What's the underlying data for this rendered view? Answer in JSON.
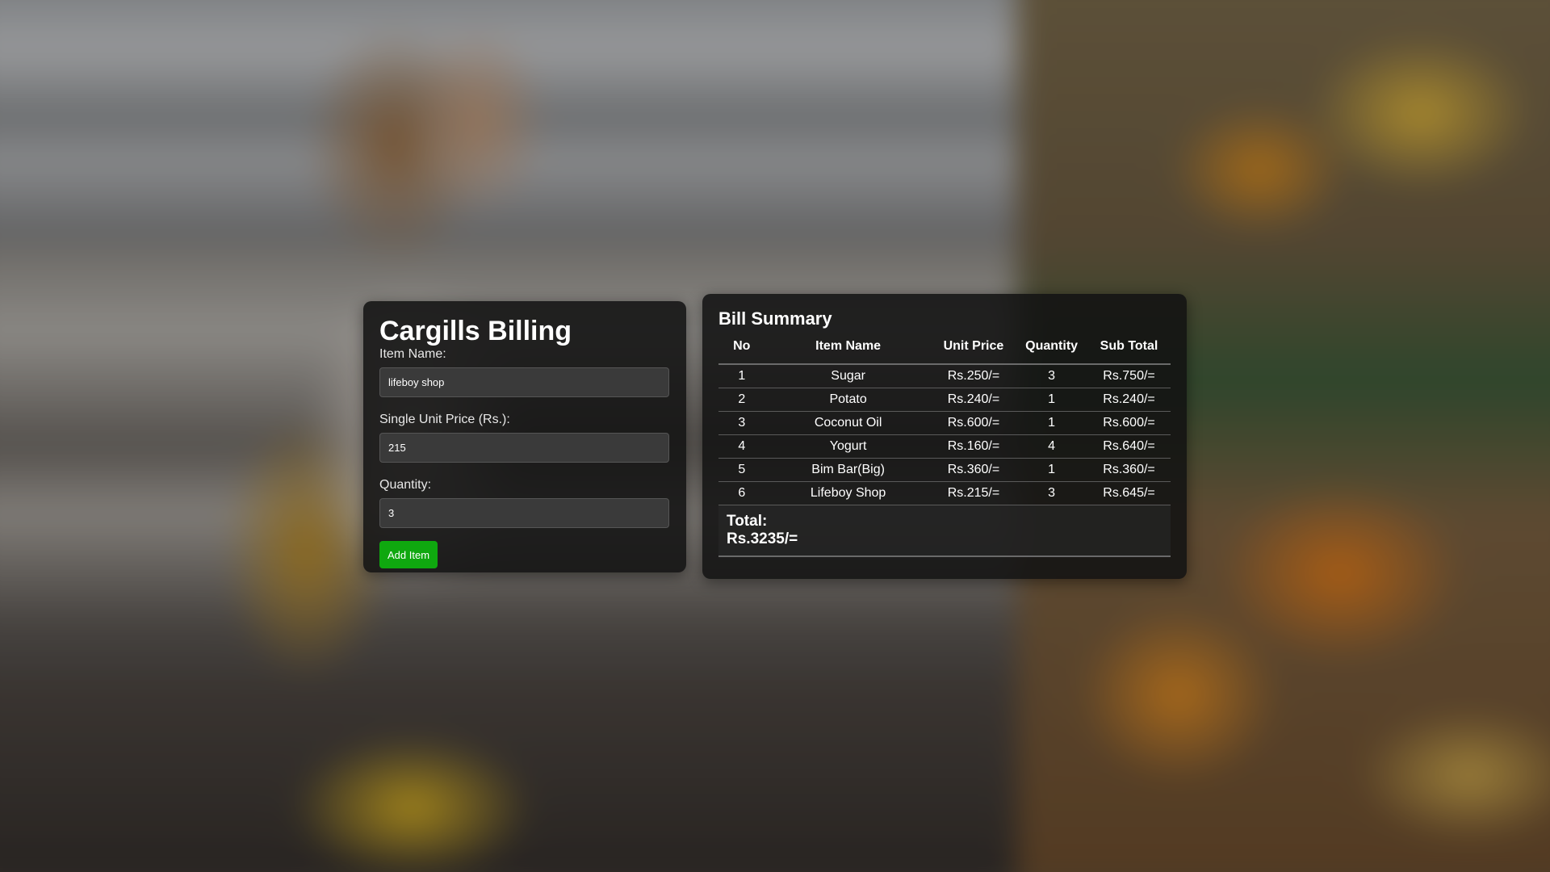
{
  "billing": {
    "title": "Cargills Billing",
    "item_name_label": "Item Name:",
    "item_name_value": "lifeboy shop",
    "unit_price_label": "Single Unit Price (Rs.):",
    "unit_price_value": "215",
    "quantity_label": "Quantity:",
    "quantity_value": "3",
    "add_button_label": "Add Item",
    "add_button_color": "#0fa80f"
  },
  "summary": {
    "title": "Bill Summary",
    "headers": [
      "No",
      "Item Name",
      "Unit Price",
      "Quantity",
      "Sub Total"
    ],
    "rows": [
      [
        "1",
        "Sugar",
        "Rs.250/=",
        "3",
        "Rs.750/="
      ],
      [
        "2",
        "Potato",
        "Rs.240/=",
        "1",
        "Rs.240/="
      ],
      [
        "3",
        "Coconut Oil",
        "Rs.600/=",
        "1",
        "Rs.600/="
      ],
      [
        "4",
        "Yogurt",
        "Rs.160/=",
        "4",
        "Rs.640/="
      ],
      [
        "5",
        "Bim Bar(Big)",
        "Rs.360/=",
        "1",
        "Rs.360/="
      ],
      [
        "6",
        "Lifeboy Shop",
        "Rs.215/=",
        "3",
        "Rs.645/="
      ]
    ],
    "total_label": "Total:",
    "total_value": "Rs.3235/="
  }
}
